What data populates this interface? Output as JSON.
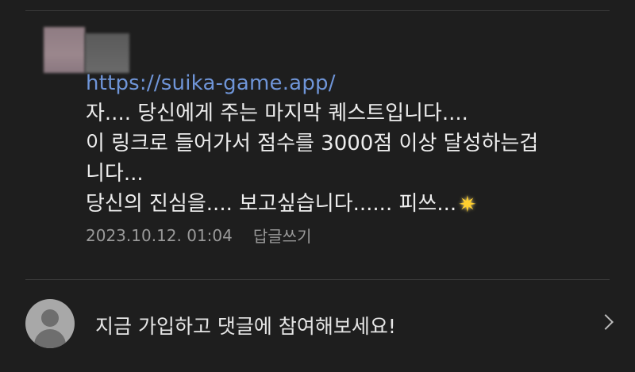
{
  "comment": {
    "link": "https://suika-game.app/",
    "lines": [
      "자.... 당신에게 주는 마지막 퀘스트입니다....",
      "이 링크로 들어가서 점수를 3000점 이상 달성하는겁",
      "니다...",
      "당신의 진심을.... 보고싶습니다...... 피쓰..."
    ],
    "timestamp": "2023.10.12. 01:04",
    "reply_label": "답글쓰기"
  },
  "join": {
    "prompt": "지금 가입하고 댓글에 참여해보세요!"
  },
  "icons": {
    "sparkle": "sparkle-emoji",
    "chevron": "chevron-right-icon",
    "avatar": "default-user-avatar"
  },
  "colors": {
    "background": "#1e1e1e",
    "link": "#6f95d8",
    "meta": "#9a9a9a"
  }
}
